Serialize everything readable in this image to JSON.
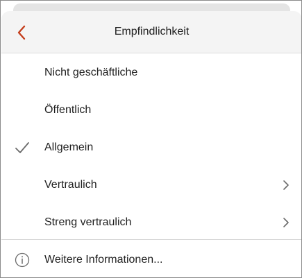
{
  "header": {
    "title": "Empfindlichkeit"
  },
  "items": [
    {
      "label": "Nicht geschäftliche",
      "selected": false,
      "has_submenu": false
    },
    {
      "label": "Öffentlich",
      "selected": false,
      "has_submenu": false
    },
    {
      "label": "Allgemein",
      "selected": true,
      "has_submenu": false
    },
    {
      "label": "Vertraulich",
      "selected": false,
      "has_submenu": true
    },
    {
      "label": "Streng vertraulich",
      "selected": false,
      "has_submenu": true
    }
  ],
  "footer": {
    "more_info_label": "Weitere Informationen..."
  },
  "colors": {
    "accent": "#c43e1c",
    "text": "#1f1f1f",
    "icon_gray": "#6b6b6b"
  },
  "icons": {
    "back": "chevron-left-icon",
    "selected": "checkmark-icon",
    "submenu": "chevron-right-icon",
    "info": "info-icon"
  }
}
